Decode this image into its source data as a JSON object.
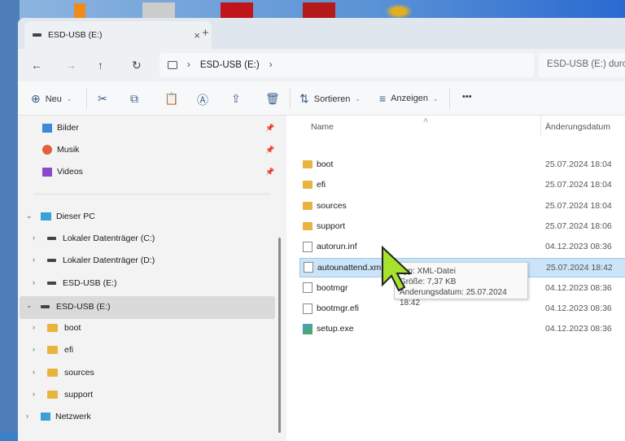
{
  "tab": {
    "title": "ESD-USB (E:)",
    "close": "×",
    "new": "+"
  },
  "nav": {
    "back": "←",
    "forward": "→",
    "up": "↑",
    "refresh": "↻",
    "breadcrumb": [
      "ESD-USB (E:)"
    ],
    "search_placeholder": "ESD-USB (E:) durchsuchen"
  },
  "toolbar": {
    "new": "Neu",
    "sort": "Sortieren",
    "view": "Anzeigen",
    "more": "•••"
  },
  "sidebar": {
    "quick": [
      {
        "label": "Bilder"
      },
      {
        "label": "Musik"
      },
      {
        "label": "Videos"
      }
    ],
    "pc": "Dieser PC",
    "drives": [
      {
        "label": "Lokaler Datenträger (C:)"
      },
      {
        "label": "Lokaler Datenträger (D:)"
      },
      {
        "label": "ESD-USB (E:)"
      }
    ],
    "usb": "ESD-USB (E:)",
    "folders": [
      {
        "label": "boot"
      },
      {
        "label": "efi"
      },
      {
        "label": "sources"
      },
      {
        "label": "support"
      }
    ],
    "network": "Netzwerk"
  },
  "columns": {
    "name": "Name",
    "date": "Änderungsdatum"
  },
  "files": [
    {
      "name": "boot",
      "date": "25.07.2024 18:04",
      "type": "folder"
    },
    {
      "name": "efi",
      "date": "25.07.2024 18:04",
      "type": "folder"
    },
    {
      "name": "sources",
      "date": "25.07.2024 18:04",
      "type": "folder"
    },
    {
      "name": "support",
      "date": "25.07.2024 18:06",
      "type": "folder"
    },
    {
      "name": "autorun.inf",
      "date": "04.12.2023 08:36",
      "type": "doc"
    },
    {
      "name": "autounattend.xml",
      "date": "25.07.2024 18:42",
      "type": "doc",
      "selected": true
    },
    {
      "name": "bootmgr",
      "date": "04.12.2023 08:36",
      "type": "doc"
    },
    {
      "name": "bootmgr.efi",
      "date": "04.12.2023 08:36",
      "type": "doc"
    },
    {
      "name": "setup.exe",
      "date": "04.12.2023 08:36",
      "type": "exe"
    }
  ],
  "tooltip": {
    "type": "Typ: XML-Datei",
    "size": "Größe: 7,37 KB",
    "date": "Änderungsdatum: 25.07.2024 18:42"
  },
  "colors": {
    "cursor": "#a6e22e",
    "selection": "#cce4f7"
  }
}
